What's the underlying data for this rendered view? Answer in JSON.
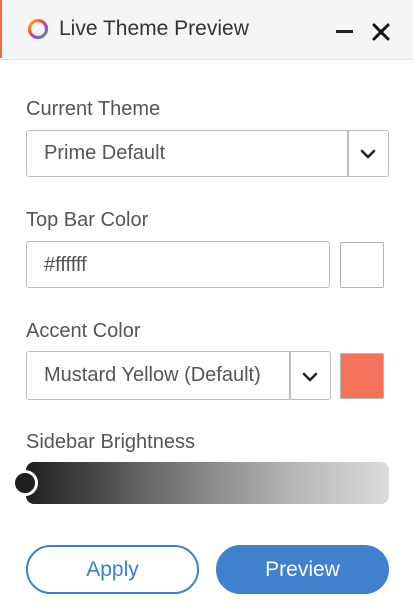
{
  "window": {
    "title": "Live Theme Preview",
    "icons": {
      "app": "color-ring-icon",
      "minimize": "minimize-icon",
      "close": "close-icon"
    }
  },
  "current_theme": {
    "label": "Current Theme",
    "value": "Prime Default"
  },
  "top_bar_color": {
    "label": "Top Bar Color",
    "value": "#ffffff",
    "swatch_color": "#ffffff"
  },
  "accent_color": {
    "label": "Accent Color",
    "value": "Mustard Yellow (Default)",
    "swatch_color": "#f4735a"
  },
  "sidebar_brightness": {
    "label": "Sidebar Brightness",
    "level": 0
  },
  "buttons": {
    "apply": "Apply",
    "preview": "Preview"
  },
  "colors": {
    "primary": "#3f80cf",
    "accent_strip": "#ef6b4e"
  }
}
